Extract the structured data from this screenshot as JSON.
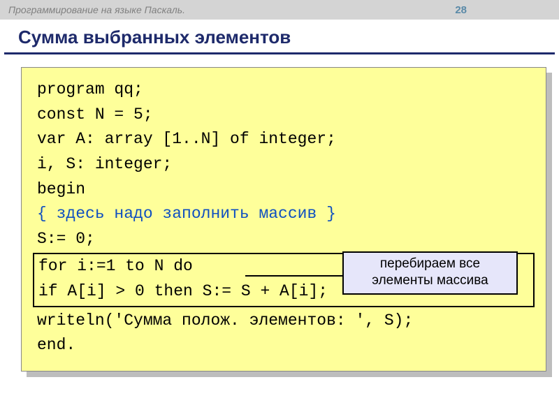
{
  "header": {
    "breadcrumb": "Программирование на языке Паскаль.",
    "page_number": "28"
  },
  "title": "Сумма выбранных элементов",
  "code": {
    "l1": "program qq;",
    "l2": "const N = 5;",
    "l3": "var A: array [1..N] of integer;",
    "l4": "    i, S: integer;",
    "l5": "begin",
    "l6": "  { здесь надо заполнить массив }",
    "l7": "  S:= 0;",
    "l8a": "  for i:=1 to N do",
    "l8b": "    if A[i] > 0 then S:= S + A[i];",
    "l9": "  writeln('Сумма полож. элементов: ', S);",
    "l10": "end."
  },
  "callout": {
    "line1": "перебираем все",
    "line2": "элементы массива"
  }
}
